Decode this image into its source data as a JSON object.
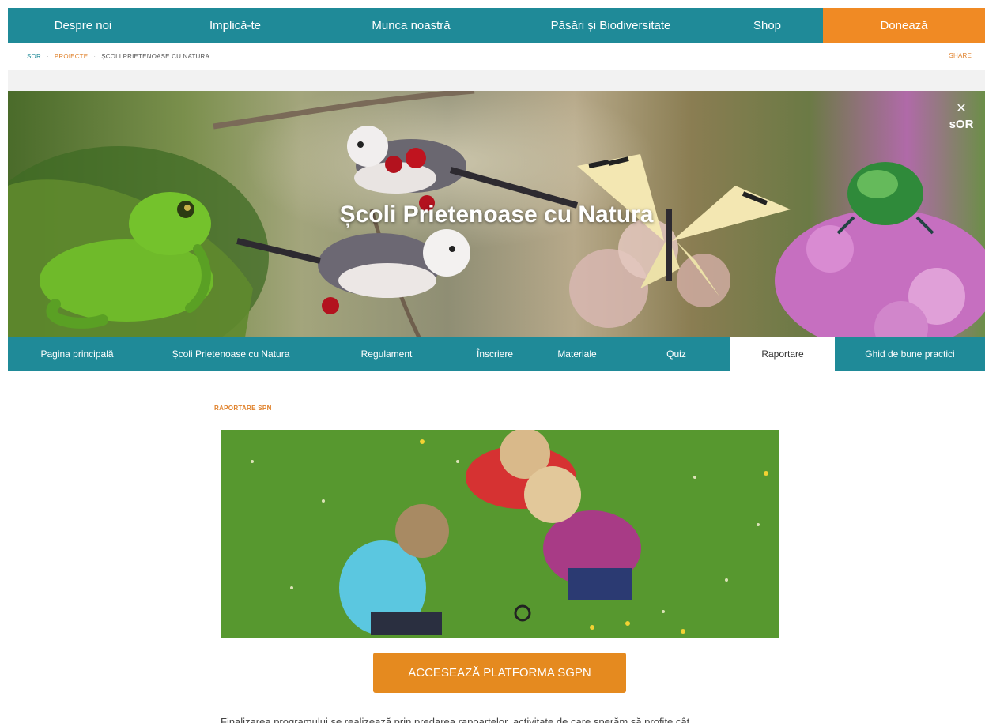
{
  "top_nav": {
    "items": [
      {
        "label": "Despre noi"
      },
      {
        "label": "Implică-te"
      },
      {
        "label": "Munca noastră"
      },
      {
        "label": "Păsări și Biodiversitate"
      },
      {
        "label": "Shop"
      },
      {
        "label": "Donează"
      }
    ]
  },
  "breadcrumb": {
    "home": "SOR",
    "section": "PROIECTE",
    "current": "ȘCOLI PRIETENOASE CU NATURA",
    "share": "SHARE"
  },
  "hero": {
    "title": "Școli Prietenoase cu Natura",
    "logo_text": "sOR"
  },
  "sub_nav": {
    "items": [
      {
        "label": "Pagina principală"
      },
      {
        "label": "Școli Prietenoase cu Natura"
      },
      {
        "label": "Regulament"
      },
      {
        "label": "Înscriere"
      },
      {
        "label": "Materiale"
      },
      {
        "label": "Quiz"
      },
      {
        "label": "Raportare"
      },
      {
        "label": "Ghid de bune practici"
      }
    ],
    "active": "Raportare"
  },
  "content": {
    "section_label": "RAPORTARE SPN",
    "cta_label": "ACCESEAZĂ PLATFORMA SGPN",
    "intro_text": "Finalizarea programului se realizează prin predarea rapoartelor, activitate de care sperăm să profite cât"
  },
  "colors": {
    "primary": "#1f8a98",
    "accent": "#f08a24",
    "cta": "#e58a1f"
  }
}
